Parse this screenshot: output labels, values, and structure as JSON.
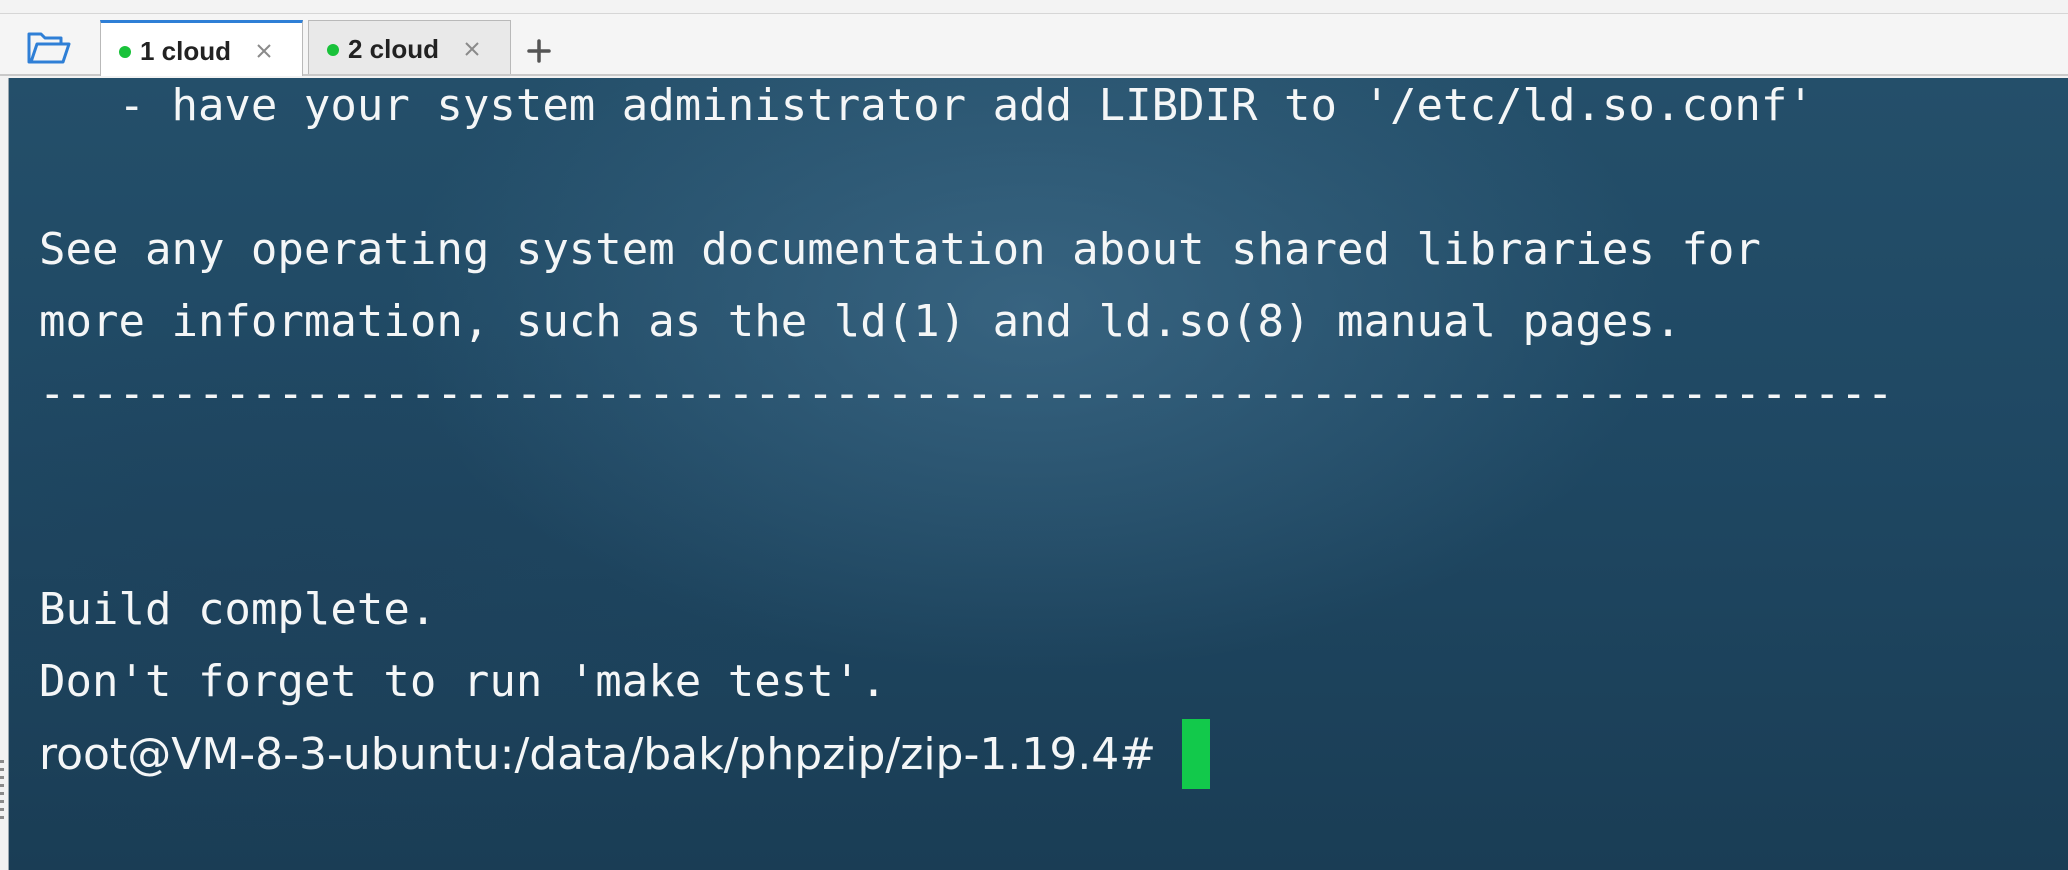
{
  "toolbar": {
    "folder_icon": "folder-open-icon",
    "add_tab_icon": "plus-icon"
  },
  "tabs": [
    {
      "label": "1 cloud",
      "status_color": "#19c23a",
      "active": true,
      "close_icon": "close-icon"
    },
    {
      "label": "2 cloud",
      "status_color": "#19c23a",
      "active": false,
      "close_icon": "close-icon"
    }
  ],
  "terminal": {
    "lines": [
      "   - have your system administrator add LIBDIR to '/etc/ld.so.conf'",
      "",
      "See any operating system documentation about shared libraries for",
      "more information, such as the ld(1) and ld.so(8) manual pages.",
      "----------------------------------------------------------------------",
      "",
      "",
      "Build complete.",
      "Don't forget to run 'make test'.",
      ""
    ],
    "prompt": "root@VM-8-3-ubuntu:/data/bak/phpzip/zip-1.19.4#",
    "cursor_color": "#12c94b"
  }
}
